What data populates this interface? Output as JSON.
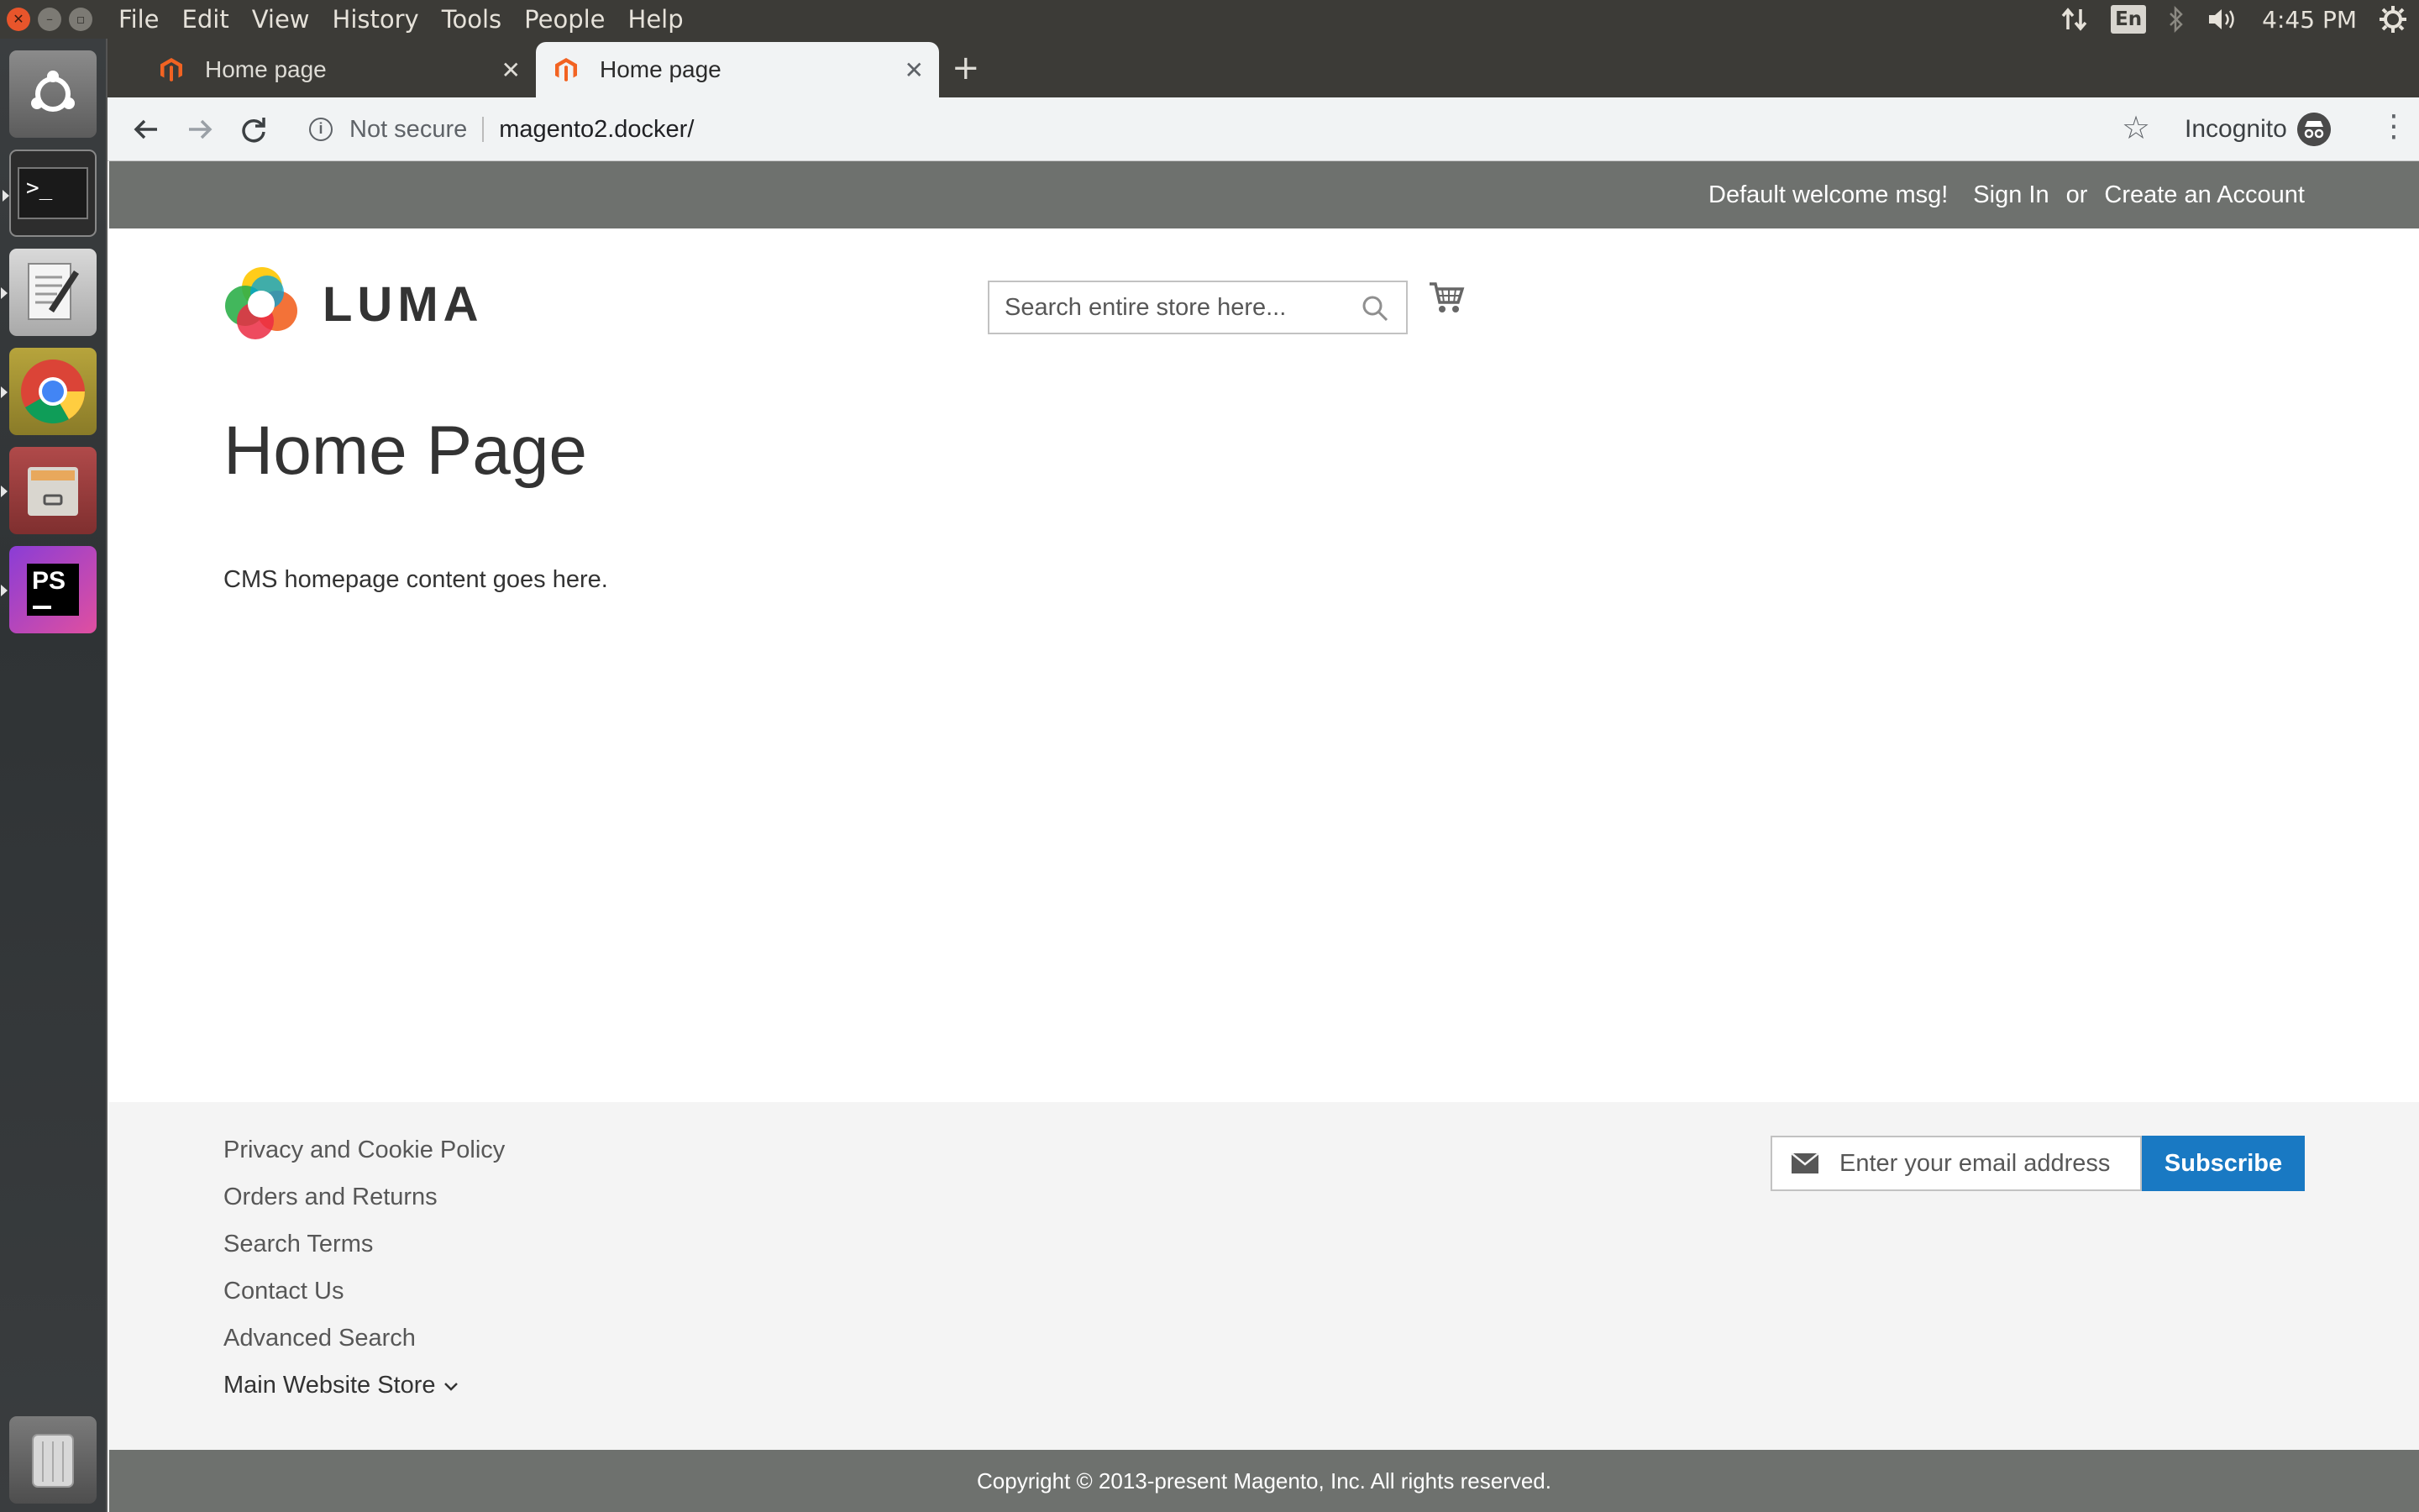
{
  "os": {
    "menu": [
      "File",
      "Edit",
      "View",
      "History",
      "Tools",
      "People",
      "Help"
    ],
    "tray": {
      "lang": "En",
      "time": "4:45 PM"
    },
    "launcher": [
      {
        "name": "ubuntu-dash-icon"
      },
      {
        "name": "terminal-icon",
        "label": ">_"
      },
      {
        "name": "text-editor-icon"
      },
      {
        "name": "chrome-icon"
      },
      {
        "name": "file-manager-icon"
      },
      {
        "name": "phpstorm-icon",
        "label": "PS"
      },
      {
        "name": "trash-icon"
      }
    ]
  },
  "browser": {
    "tabs": [
      {
        "title": "Home page"
      },
      {
        "title": "Home page"
      }
    ],
    "new_tab": "+",
    "close": "✕",
    "security": "Not secure",
    "url": "magento2.docker/",
    "incognito": "Incognito"
  },
  "site": {
    "welcome": "Default welcome msg!",
    "sign_in": "Sign In",
    "or": "or",
    "create_account": "Create an Account",
    "logo_text": "LUMA",
    "search_placeholder": "Search entire store here...",
    "page_title": "Home Page",
    "content": "CMS homepage content goes here.",
    "footer_links": [
      "Privacy and Cookie Policy",
      "Orders and Returns",
      "Search Terms",
      "Contact Us",
      "Advanced Search"
    ],
    "store_switcher": "Main Website Store",
    "newsletter_placeholder": "Enter your email address",
    "subscribe": "Subscribe",
    "copyright": "Copyright © 2013-present Magento, Inc. All rights reserved."
  },
  "colors": {
    "panel": "#6e716e",
    "accent": "#1979c3",
    "footer_bg": "#f4f4f4",
    "magento_orange": "#f26322"
  }
}
